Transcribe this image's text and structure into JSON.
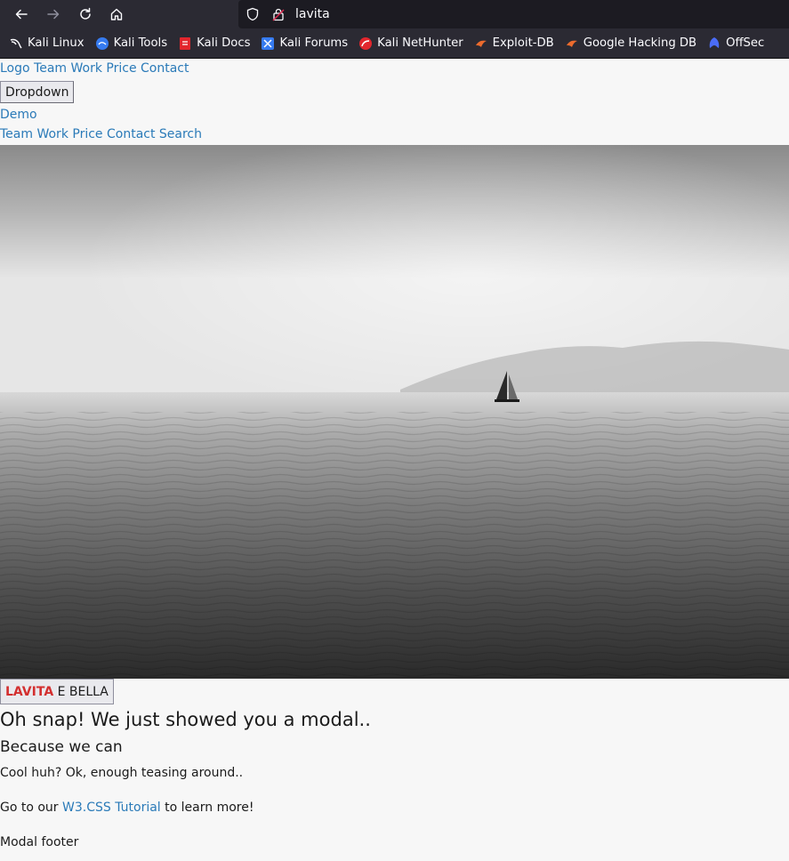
{
  "browser": {
    "url": "lavita",
    "bookmarks": [
      {
        "label": "Kali Linux",
        "icon": "kali-dragon-icon"
      },
      {
        "label": "Kali Tools",
        "icon": "kali-tools-icon"
      },
      {
        "label": "Kali Docs",
        "icon": "kali-docs-icon"
      },
      {
        "label": "Kali Forums",
        "icon": "kali-forums-icon"
      },
      {
        "label": "Kali NetHunter",
        "icon": "kali-nethunter-icon"
      },
      {
        "label": "Exploit-DB",
        "icon": "exploit-db-icon"
      },
      {
        "label": "Google Hacking DB",
        "icon": "ghdb-icon"
      },
      {
        "label": "OffSec",
        "icon": "offsec-icon"
      }
    ]
  },
  "nav": {
    "logo": "Logo",
    "links": [
      "Team",
      "Work",
      "Price",
      "Contact"
    ]
  },
  "dropdown": {
    "label": "Dropdown"
  },
  "demo": {
    "label": "Demo"
  },
  "nav2": {
    "links": [
      "Team",
      "Work",
      "Price",
      "Contact",
      "Search"
    ]
  },
  "brand": {
    "red": "LAVITA",
    "rest": "E BELLA"
  },
  "modal": {
    "title": "Oh snap! We just showed you a modal..",
    "subtitle": "Because we can",
    "p1": "Cool huh? Ok, enough teasing around..",
    "p2_pre": "Go to our",
    "p2_link": "W3.CSS Tutorial",
    "p2_post": "to learn more!",
    "footer": "Modal footer"
  },
  "colors": {
    "link": "#2a7ab8",
    "brand_red": "#d32f2f",
    "chrome": "#2b2a33"
  }
}
